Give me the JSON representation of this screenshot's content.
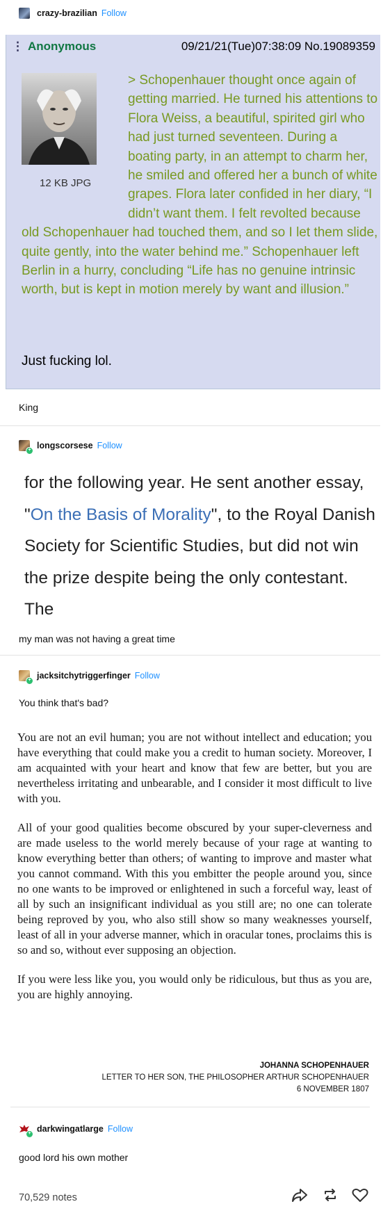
{
  "post1": {
    "username": "crazy-brazilian",
    "follow_label": "Follow",
    "chan_post": {
      "name": "Anonymous",
      "datetime": "09/21/21(Tue)07:38:09 No.19089359",
      "file_size": "12 KB JPG",
      "greentext": "> Schopenhauer thought once again of getting married. He turned his attentions to Flora Weiss, a beautiful, spirited girl who had just turned seventeen. During a boating party, in an attempt to charm her, he smiled and offered her a bunch of white grapes. Flora later confided in her diary, “I didn’t want them. I felt revolted because old Schopenhauer had touched them, and so I let them slide, quite gently, into the water behind me.” Schopenhauer left Berlin in a hurry, concluding “Life has no genuine intrinsic worth, but is kept in motion merely by want and illusion.”",
      "reply": "Just fucking lol."
    },
    "comment": "King"
  },
  "post2": {
    "username": "longscorsese",
    "follow_label": "Follow",
    "excerpt_before": "for the following year. He sent another essay, \"",
    "excerpt_link": "On the Basis of Morality",
    "excerpt_after": "\", to the Royal Danish Society for Scientific Studies, but did not win the prize despite being the only contestant. The",
    "comment": "my man was not having a great time"
  },
  "post3": {
    "username": "jacksitchytriggerfinger",
    "follow_label": "Follow",
    "comment": "You think that's bad?",
    "letter_p1": "You are not an evil human; you are not without intellect and education; you have everything that could make you a credit to human society. Moreover, I am acquainted with your heart and know that few are better, but you are nevertheless irritating and unbearable, and I consider it most difficult to live with you.",
    "letter_p2": "All of your good qualities become obscured by your super-cleverness and are made useless to the world merely because of your rage at wanting to know everything better than others; of wanting to improve and master what you cannot command. With this you embitter the people around you, since no one wants to be improved or enlightened in such a forceful way, least of all by such an insignificant individual as you still are; no one can tolerate being reproved by you, who also still show so many weaknesses yourself, least of all in your adverse manner, which in oracular tones, proclaims this is so and so, without ever supposing an objection.",
    "letter_p3": "If you were less like you, you would only be ridiculous, but thus as you are, you are highly annoying.",
    "sig_name": "JOHANNA SCHOPENHAUER",
    "sig_line": "LETTER TO HER SON, THE PHILOSOPHER ARTHUR SCHOPENHAUER",
    "sig_date": "6 NOVEMBER 1807"
  },
  "post4": {
    "username": "darkwingatlarge",
    "follow_label": "Follow",
    "comment": "good lord his own mother"
  },
  "footer": {
    "notes": "70,529 notes",
    "icons": [
      "share-icon",
      "reblog-icon",
      "like-icon"
    ]
  }
}
